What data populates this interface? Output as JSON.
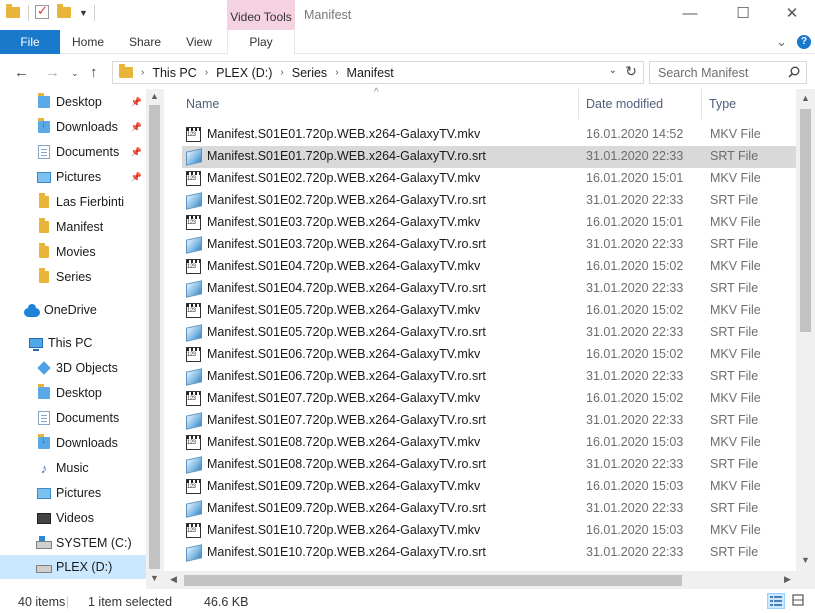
{
  "window": {
    "title": "Manifest",
    "contextual_tab_group": "Video Tools",
    "controls": [
      "—",
      "☐",
      "✕"
    ]
  },
  "ribbon": {
    "tabs": [
      "File",
      "Home",
      "Share",
      "View",
      "Play"
    ]
  },
  "address": {
    "crumbs": [
      "This PC",
      "PLEX (D:)",
      "Series",
      "Manifest"
    ],
    "search_placeholder": "Search Manifest"
  },
  "nav": {
    "items": [
      {
        "label": "Desktop",
        "icon": "folder-blue-icon",
        "pinned": true
      },
      {
        "label": "Downloads",
        "icon": "download-folder-icon",
        "pinned": true
      },
      {
        "label": "Documents",
        "icon": "documents-icon",
        "pinned": true
      },
      {
        "label": "Pictures",
        "icon": "pictures-icon",
        "pinned": true
      },
      {
        "label": "Las Fierbinti",
        "icon": "folder-icon",
        "pinned": false
      },
      {
        "label": "Manifest",
        "icon": "folder-icon",
        "pinned": false
      },
      {
        "label": "Movies",
        "icon": "folder-icon",
        "pinned": false
      },
      {
        "label": "Series",
        "icon": "folder-icon",
        "pinned": false
      },
      {
        "label": "OneDrive",
        "icon": "onedrive-icon",
        "pinned": false
      },
      {
        "label": "This PC",
        "icon": "computer-icon",
        "pinned": false
      },
      {
        "label": "3D Objects",
        "icon": "cube-icon",
        "pinned": false
      },
      {
        "label": "Desktop",
        "icon": "folder-blue-icon",
        "pinned": false
      },
      {
        "label": "Documents",
        "icon": "documents-icon",
        "pinned": false
      },
      {
        "label": "Downloads",
        "icon": "download-folder-icon",
        "pinned": false
      },
      {
        "label": "Music",
        "icon": "music-icon",
        "pinned": false
      },
      {
        "label": "Pictures",
        "icon": "pictures-icon",
        "pinned": false
      },
      {
        "label": "Videos",
        "icon": "videos-icon",
        "pinned": false
      },
      {
        "label": "SYSTEM (C:)",
        "icon": "system-drive-icon",
        "pinned": false
      },
      {
        "label": "PLEX (D:)",
        "icon": "drive-icon",
        "pinned": false,
        "selected": true
      }
    ]
  },
  "filelist": {
    "columns": {
      "name": "Name",
      "date": "Date modified",
      "type": "Type"
    },
    "selected_index": 1,
    "rows": [
      {
        "name": "Manifest.S01E01.720p.WEB.x264-GalaxyTV.mkv",
        "date": "16.01.2020 14:52",
        "type": "MKV File",
        "kind": "mkv"
      },
      {
        "name": "Manifest.S01E01.720p.WEB.x264-GalaxyTV.ro.srt",
        "date": "31.01.2020 22:33",
        "type": "SRT File",
        "kind": "srt"
      },
      {
        "name": "Manifest.S01E02.720p.WEB.x264-GalaxyTV.mkv",
        "date": "16.01.2020 15:01",
        "type": "MKV File",
        "kind": "mkv"
      },
      {
        "name": "Manifest.S01E02.720p.WEB.x264-GalaxyTV.ro.srt",
        "date": "31.01.2020 22:33",
        "type": "SRT File",
        "kind": "srt"
      },
      {
        "name": "Manifest.S01E03.720p.WEB.x264-GalaxyTV.mkv",
        "date": "16.01.2020 15:01",
        "type": "MKV File",
        "kind": "mkv"
      },
      {
        "name": "Manifest.S01E03.720p.WEB.x264-GalaxyTV.ro.srt",
        "date": "31.01.2020 22:33",
        "type": "SRT File",
        "kind": "srt"
      },
      {
        "name": "Manifest.S01E04.720p.WEB.x264-GalaxyTV.mkv",
        "date": "16.01.2020 15:02",
        "type": "MKV File",
        "kind": "mkv"
      },
      {
        "name": "Manifest.S01E04.720p.WEB.x264-GalaxyTV.ro.srt",
        "date": "31.01.2020 22:33",
        "type": "SRT File",
        "kind": "srt"
      },
      {
        "name": "Manifest.S01E05.720p.WEB.x264-GalaxyTV.mkv",
        "date": "16.01.2020 15:02",
        "type": "MKV File",
        "kind": "mkv"
      },
      {
        "name": "Manifest.S01E05.720p.WEB.x264-GalaxyTV.ro.srt",
        "date": "31.01.2020 22:33",
        "type": "SRT File",
        "kind": "srt"
      },
      {
        "name": "Manifest.S01E06.720p.WEB.x264-GalaxyTV.mkv",
        "date": "16.01.2020 15:02",
        "type": "MKV File",
        "kind": "mkv"
      },
      {
        "name": "Manifest.S01E06.720p.WEB.x264-GalaxyTV.ro.srt",
        "date": "31.01.2020 22:33",
        "type": "SRT File",
        "kind": "srt"
      },
      {
        "name": "Manifest.S01E07.720p.WEB.x264-GalaxyTV.mkv",
        "date": "16.01.2020 15:02",
        "type": "MKV File",
        "kind": "mkv"
      },
      {
        "name": "Manifest.S01E07.720p.WEB.x264-GalaxyTV.ro.srt",
        "date": "31.01.2020 22:33",
        "type": "SRT File",
        "kind": "srt"
      },
      {
        "name": "Manifest.S01E08.720p.WEB.x264-GalaxyTV.mkv",
        "date": "16.01.2020 15:03",
        "type": "MKV File",
        "kind": "mkv"
      },
      {
        "name": "Manifest.S01E08.720p.WEB.x264-GalaxyTV.ro.srt",
        "date": "31.01.2020 22:33",
        "type": "SRT File",
        "kind": "srt"
      },
      {
        "name": "Manifest.S01E09.720p.WEB.x264-GalaxyTV.mkv",
        "date": "16.01.2020 15:03",
        "type": "MKV File",
        "kind": "mkv"
      },
      {
        "name": "Manifest.S01E09.720p.WEB.x264-GalaxyTV.ro.srt",
        "date": "31.01.2020 22:33",
        "type": "SRT File",
        "kind": "srt"
      },
      {
        "name": "Manifest.S01E10.720p.WEB.x264-GalaxyTV.mkv",
        "date": "16.01.2020 15:03",
        "type": "MKV File",
        "kind": "mkv"
      },
      {
        "name": "Manifest.S01E10.720p.WEB.x264-GalaxyTV.ro.srt",
        "date": "31.01.2020 22:33",
        "type": "SRT File",
        "kind": "srt"
      }
    ]
  },
  "status": {
    "item_count": "40 items",
    "selection": "1 item selected",
    "size": "46.6 KB"
  },
  "colors": {
    "file_tab": "#1979ca",
    "contextual_tab": "#f4d2e1",
    "selection_nav": "#cce8ff",
    "selection_row": "#d9d9d9"
  }
}
